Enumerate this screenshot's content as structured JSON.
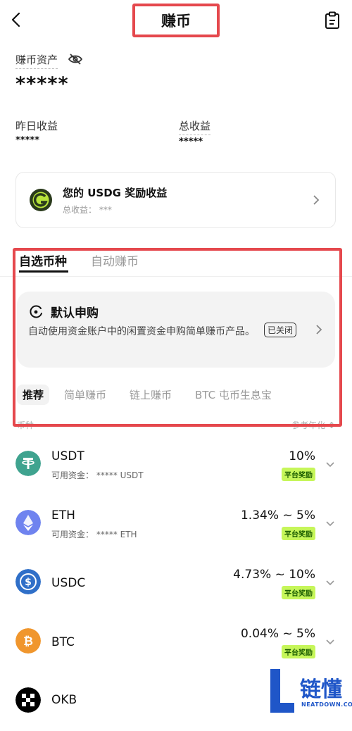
{
  "header": {
    "title": "赚币"
  },
  "assets": {
    "label": "赚币资产",
    "value": "*****"
  },
  "earnings": {
    "yesterday_label": "昨日收益",
    "yesterday_value": "*****",
    "total_label": "总收益",
    "total_value": "*****"
  },
  "usdg_card": {
    "title": "您的 USDG 奖励收益",
    "subtitle": "总收益： ***"
  },
  "tabs": [
    {
      "label": "自选币种"
    },
    {
      "label": "自动赚币"
    }
  ],
  "auto_subscribe": {
    "title": "默认申购",
    "description": "自动使用资金账户中的闲置资金申购简单赚币产品。",
    "status": "已关闭"
  },
  "sub_tabs": [
    {
      "label": "推荐"
    },
    {
      "label": "简单赚币"
    },
    {
      "label": "链上赚币"
    },
    {
      "label": "BTC 屯币生息宝"
    }
  ],
  "list_header": {
    "left": "币种",
    "right": "参考年化 ↕"
  },
  "coins": [
    {
      "name": "USDT",
      "available": "可用资金： ***** USDT",
      "rate": "10%",
      "badge": "平台奖励",
      "color": "#3fa38f"
    },
    {
      "name": "ETH",
      "available": "可用资金： ***** ETH",
      "rate": "1.34% ~ 5%",
      "badge": "平台奖励",
      "color": "#6f83ef"
    },
    {
      "name": "USDC",
      "available": "",
      "rate": "4.73% ~ 10%",
      "badge": "平台奖励",
      "color": "#2f6fc8"
    },
    {
      "name": "BTC",
      "available": "",
      "rate": "0.04% ~ 5%",
      "badge": "平台奖励",
      "color": "#f0962d"
    },
    {
      "name": "OKB",
      "available": "",
      "rate": "",
      "badge": "",
      "color": "#000000"
    }
  ],
  "watermark": {
    "brand": "链懂",
    "domain": "NEATDOWN.COM"
  },
  "colors": {
    "highlight": "#e5484d",
    "badge_bg": "#c6f65a"
  }
}
